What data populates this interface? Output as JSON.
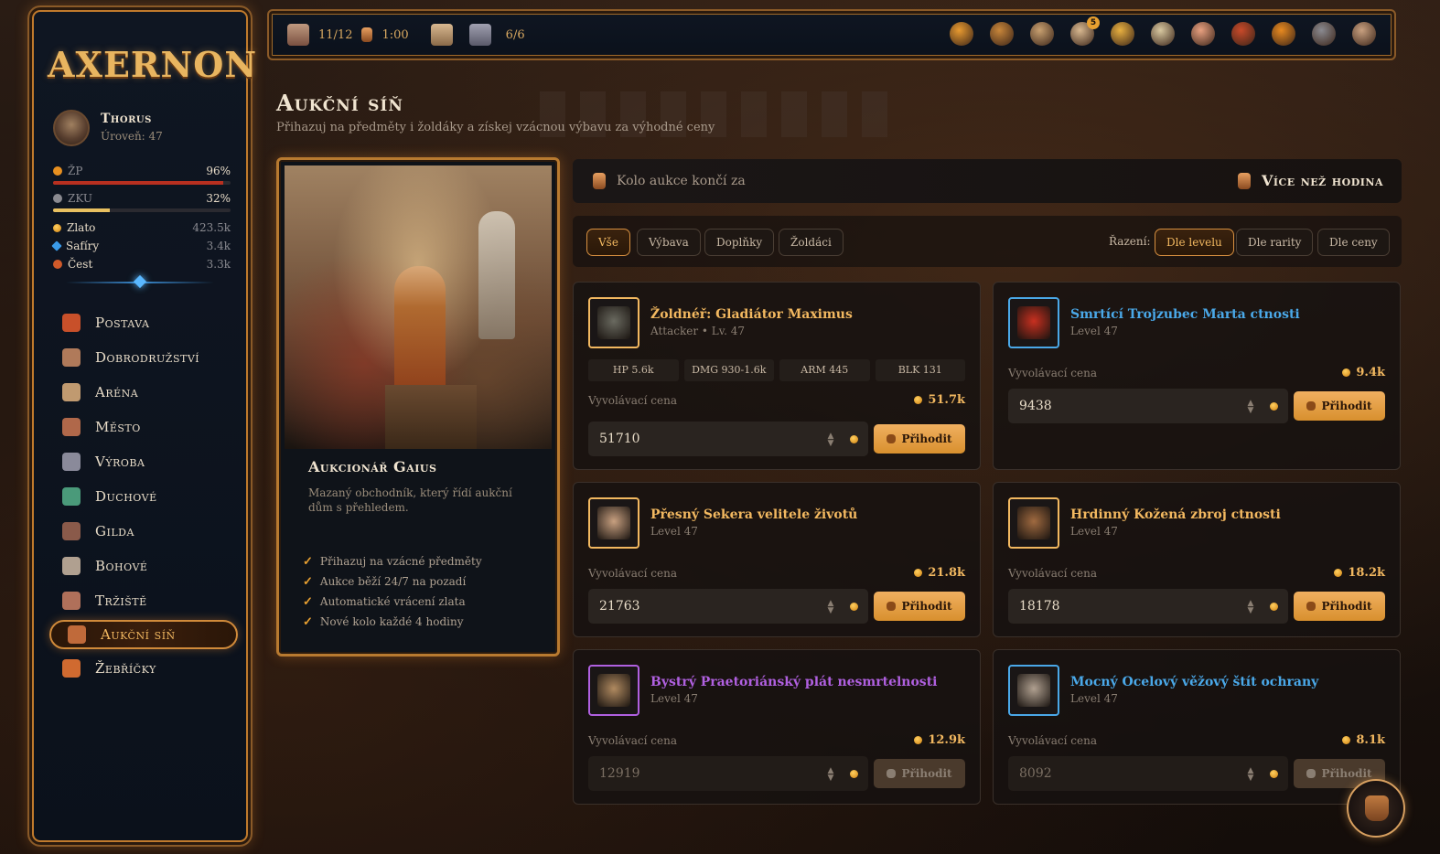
{
  "app": {
    "logo": "AXERNON"
  },
  "player": {
    "name": "Thorus",
    "level": "Úroveň: 47"
  },
  "stats": {
    "hp": {
      "label": "ŽP",
      "value": "96%",
      "fill": 0.96,
      "color": "#b83020"
    },
    "xp": {
      "label": "ZKU",
      "value": "32%",
      "fill": 0.32,
      "color": "#e8c060"
    },
    "gold": {
      "label": "Zlato",
      "value": "423.5k"
    },
    "sapphires": {
      "label": "Safíry",
      "value": "3.4k"
    },
    "honor": {
      "label": "Čest",
      "value": "3.3k"
    }
  },
  "nav": [
    {
      "label": "Postava",
      "icon": "helmet-icon",
      "color": "#c8502a"
    },
    {
      "label": "Dobrodružství",
      "icon": "adventurer-icon",
      "color": "#b07a5a"
    },
    {
      "label": "Aréna",
      "icon": "arena-icon",
      "color": "#c09a70"
    },
    {
      "label": "Město",
      "icon": "city-icon",
      "color": "#b0684a"
    },
    {
      "label": "Výroba",
      "icon": "hammer-icon",
      "color": "#8a8a9a"
    },
    {
      "label": "Duchové",
      "icon": "ghost-icon",
      "color": "#4a9a7a"
    },
    {
      "label": "Gilda",
      "icon": "guild-icon",
      "color": "#8a5a4a"
    },
    {
      "label": "Bohové",
      "icon": "god-icon",
      "color": "#b0a090"
    },
    {
      "label": "Tržiště",
      "icon": "market-icon",
      "color": "#b0705a"
    },
    {
      "label": "Aukční síň",
      "icon": "auction-icon",
      "color": "#c06a3a"
    },
    {
      "label": "Žebříčky",
      "icon": "ranking-icon",
      "color": "#d06a30"
    }
  ],
  "topbar": {
    "energy": "11/12",
    "timer": "1:00",
    "towers": "6/6",
    "notification_count": "5",
    "icons": [
      "crown-icon",
      "compass-icon",
      "map-icon",
      "scroll-icon",
      "trophy-icon",
      "scrolls-icon",
      "letter-icon",
      "shield-badge-icon",
      "help-icon",
      "settings-icon",
      "temple-icon"
    ]
  },
  "page": {
    "title": "Aukční síň",
    "subtitle": "Přihazuj na předměty i žoldáky a získej vzácnou výbavu za výhodné ceny"
  },
  "auctioneer": {
    "name": "Aukcionář Gaius",
    "description": "Mazaný obchodník, který řídí aukční dům s přehledem.",
    "features": [
      "Přihazuj na vzácné předměty",
      "Aukce běží 24/7 na pozadí",
      "Automatické vrácení zlata",
      "Nové kolo každé 4 hodiny"
    ]
  },
  "timer": {
    "label": "Kolo aukce končí za",
    "value": "Více než hodina"
  },
  "filters": {
    "tabs": [
      "Vše",
      "Výbava",
      "Doplňky",
      "Žoldáci"
    ],
    "sort_label": "Řazení:",
    "sort": [
      "Dle levelu",
      "Dle rarity",
      "Dle ceny"
    ]
  },
  "labels": {
    "starting_price": "Vyvolávací cena",
    "bid": "Přihodit"
  },
  "items": [
    {
      "title": "Žoldnéř: Gladiátor Maximus",
      "sub": "Attacker • Lv. 47",
      "color": "#f2b860",
      "price": "51.7k",
      "bid": "51710",
      "stats": [
        "HP 5.6k",
        "DMG 930-1.6k",
        "ARM 445",
        "BLK 131"
      ]
    },
    {
      "title": "Smrtící Trojzubec Marta ctnosti",
      "sub": "Level 47",
      "color": "#4aa8e8",
      "price": "9.4k",
      "bid": "9438"
    },
    {
      "title": "Přesný Sekera velitele životů",
      "sub": "Level 47",
      "color": "#f2b860",
      "price": "21.8k",
      "bid": "21763"
    },
    {
      "title": "Hrdinný Kožená zbroj ctnosti",
      "sub": "Level 47",
      "color": "#f2b860",
      "price": "18.2k",
      "bid": "18178"
    },
    {
      "title": "Bystrý Praetoriánský plát nesmrtelnosti",
      "sub": "Level 47",
      "color": "#b060e0",
      "price": "12.9k",
      "bid": "12919"
    },
    {
      "title": "Mocný Ocelový věžový štít ochrany",
      "sub": "Level 47",
      "color": "#4aa8e8",
      "price": "8.1k",
      "bid": "8092"
    }
  ]
}
